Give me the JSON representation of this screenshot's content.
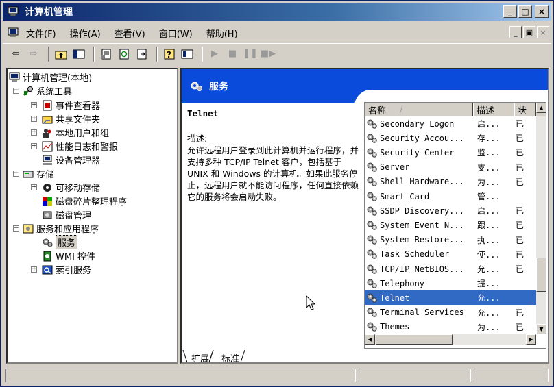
{
  "window": {
    "title": "计算机管理",
    "controls": [
      "_",
      "□",
      "×"
    ]
  },
  "menu": {
    "items": [
      "文件(F)",
      "操作(A)",
      "查看(V)",
      "窗口(W)",
      "帮助(H)"
    ],
    "mdi_controls": [
      "_",
      "▣",
      "×"
    ]
  },
  "toolbar": {
    "buttons": [
      "back-icon",
      "forward-icon",
      "up-folder-icon",
      "show-hide-tree-icon",
      "properties-icon",
      "refresh-icon",
      "export-list-icon",
      "help-icon",
      "console-icon",
      "start-service-icon",
      "stop-service-icon",
      "pause-service-icon",
      "restart-service-icon"
    ]
  },
  "tree": {
    "root": "计算机管理(本地)",
    "nodes": [
      {
        "label": "系统工具",
        "expander": "−"
      },
      {
        "label": "事件查看器",
        "expander": "+"
      },
      {
        "label": "共享文件夹",
        "expander": "+"
      },
      {
        "label": "本地用户和组",
        "expander": "+"
      },
      {
        "label": "性能日志和警报",
        "expander": "+"
      },
      {
        "label": "设备管理器",
        "expander": ""
      },
      {
        "label": "存储",
        "expander": "−"
      },
      {
        "label": "可移动存储",
        "expander": "+"
      },
      {
        "label": "磁盘碎片整理程序",
        "expander": ""
      },
      {
        "label": "磁盘管理",
        "expander": ""
      },
      {
        "label": "服务和应用程序",
        "expander": "−"
      },
      {
        "label": "服务",
        "expander": ""
      },
      {
        "label": "WMI 控件",
        "expander": ""
      },
      {
        "label": "索引服务",
        "expander": "+"
      }
    ]
  },
  "panel": {
    "banner_title": "服务",
    "service_name": "Telnet",
    "desc_label": "描述:",
    "desc_text": "允许远程用户登录到此计算机并运行程序，并支持多种 TCP/IP Telnet 客户，包括基于 UNIX 和 Windows 的计算机。如果此服务停止，远程用户就不能访问程序，任何直接依赖它的服务将会启动失败。"
  },
  "list": {
    "columns": [
      "名称",
      "描述",
      "状"
    ],
    "sort_indicator": "/",
    "rows": [
      {
        "name": "Secondary Logon",
        "desc": "启...",
        "status": "已"
      },
      {
        "name": "Security Accou...",
        "desc": "存...",
        "status": "已"
      },
      {
        "name": "Security Center",
        "desc": "监...",
        "status": "已"
      },
      {
        "name": "Server",
        "desc": "支...",
        "status": "已"
      },
      {
        "name": "Shell Hardware...",
        "desc": "为...",
        "status": "已"
      },
      {
        "name": "Smart Card",
        "desc": "管...",
        "status": ""
      },
      {
        "name": "SSDP Discovery...",
        "desc": "启...",
        "status": "已"
      },
      {
        "name": "System Event N...",
        "desc": "跟...",
        "status": "已"
      },
      {
        "name": "System Restore...",
        "desc": "执...",
        "status": "已"
      },
      {
        "name": "Task Scheduler",
        "desc": "使...",
        "status": "已"
      },
      {
        "name": "TCP/IP NetBIOS...",
        "desc": "允...",
        "status": "已"
      },
      {
        "name": "Telephony",
        "desc": "提...",
        "status": ""
      },
      {
        "name": "Telnet",
        "desc": "允...",
        "status": "",
        "selected": true
      },
      {
        "name": "Terminal Services",
        "desc": "允...",
        "status": "已"
      },
      {
        "name": "Themes",
        "desc": "为...",
        "status": "已"
      }
    ]
  },
  "tabs": [
    "扩展",
    "标准"
  ],
  "colors": {
    "title_gradient_start": "#0a246a",
    "banner": "#0a4bdc",
    "selection": "#316ac5",
    "face": "#d4d0c8"
  }
}
